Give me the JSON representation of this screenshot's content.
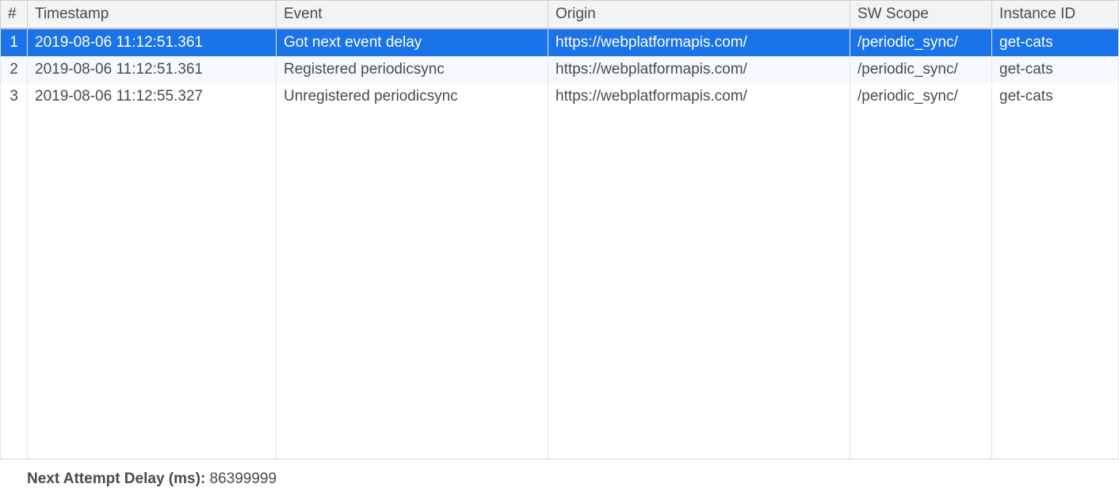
{
  "table": {
    "columns": {
      "index": "#",
      "timestamp": "Timestamp",
      "event": "Event",
      "origin": "Origin",
      "scope": "SW Scope",
      "instance_id": "Instance ID"
    },
    "rows": [
      {
        "index": "1",
        "timestamp": "2019-08-06 11:12:51.361",
        "event": "Got next event delay",
        "origin": "https://webplatformapis.com/",
        "scope": "/periodic_sync/",
        "instance_id": "get-cats",
        "selected": true
      },
      {
        "index": "2",
        "timestamp": "2019-08-06 11:12:51.361",
        "event": "Registered periodicsync",
        "origin": "https://webplatformapis.com/",
        "scope": "/periodic_sync/",
        "instance_id": "get-cats",
        "selected": false
      },
      {
        "index": "3",
        "timestamp": "2019-08-06 11:12:55.327",
        "event": "Unregistered periodicsync",
        "origin": "https://webplatformapis.com/",
        "scope": "/periodic_sync/",
        "instance_id": "get-cats",
        "selected": false
      }
    ]
  },
  "status": {
    "label": "Next Attempt Delay (ms): ",
    "value": "86399999"
  }
}
